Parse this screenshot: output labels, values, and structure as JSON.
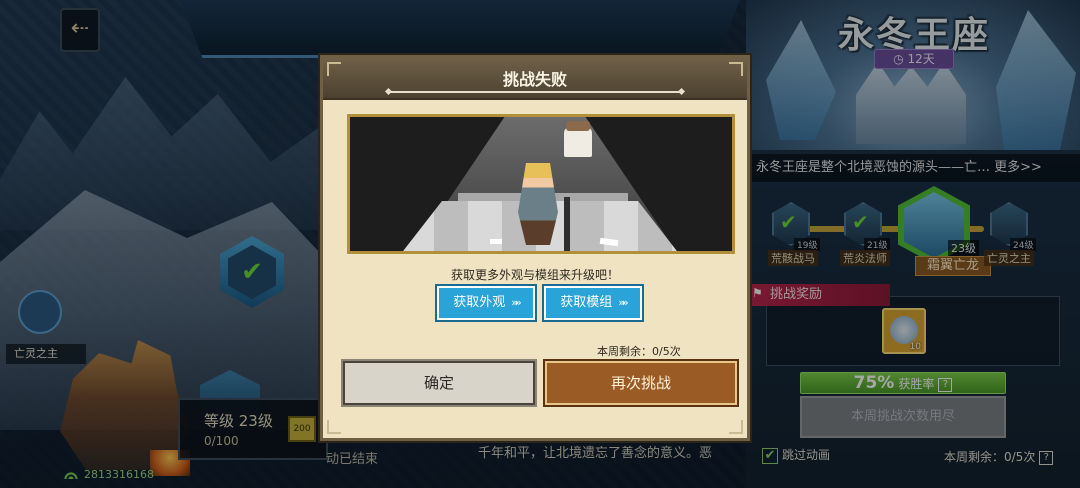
{
  "background": {
    "back_label": "⇠",
    "left_boss_label": "亡灵之主",
    "level_label": "等级 23级",
    "level_progress": "0/100",
    "level_badge": "200",
    "player_id": "2813316168",
    "story_text": "千年和平，让北境遗忘了善念的意义。恶",
    "ended_text": "动已结束"
  },
  "realm": {
    "title": "永冬王座",
    "timer": "12天",
    "description": "永冬王座是整个北境恶蚀的源头——亡… 更多>>",
    "bosses": [
      {
        "name": "荒骸战马",
        "level": "19级",
        "cleared": true
      },
      {
        "name": "荒炎法师",
        "level": "21级",
        "cleared": true
      },
      {
        "name": "霜翼亡龙",
        "level": "23级",
        "cleared": false,
        "current": true
      },
      {
        "name": "亡灵之主",
        "level": "24级",
        "cleared": false
      }
    ],
    "rewards_label": "挑战奖励",
    "reward_count": "10",
    "winrate_value": "75%",
    "winrate_label": "获胜率",
    "help_glyph": "?",
    "spent_label": "本周挑战次数用尽",
    "skip_label": "跳过动画",
    "weekly_remaining": "本周剩余：0/5次"
  },
  "modal": {
    "title": "挑战失败",
    "hint": "获取更多外观与模组来升级吧！",
    "get_look_label": "获取外观",
    "get_mod_label": "获取模组",
    "arrows_glyph": "»»",
    "weekly_remaining": "本周剩余：0/5次",
    "ok_label": "确定",
    "retry_label": "再次挑战"
  },
  "colors": {
    "modal_bg": "#efe3c2",
    "get_button": "#2aa3d8",
    "retry_button": "#9b5b25",
    "winrate_green": "#5fb33a",
    "timer_purple": "#6a4f9d",
    "rewards_red": "#b9264d"
  }
}
